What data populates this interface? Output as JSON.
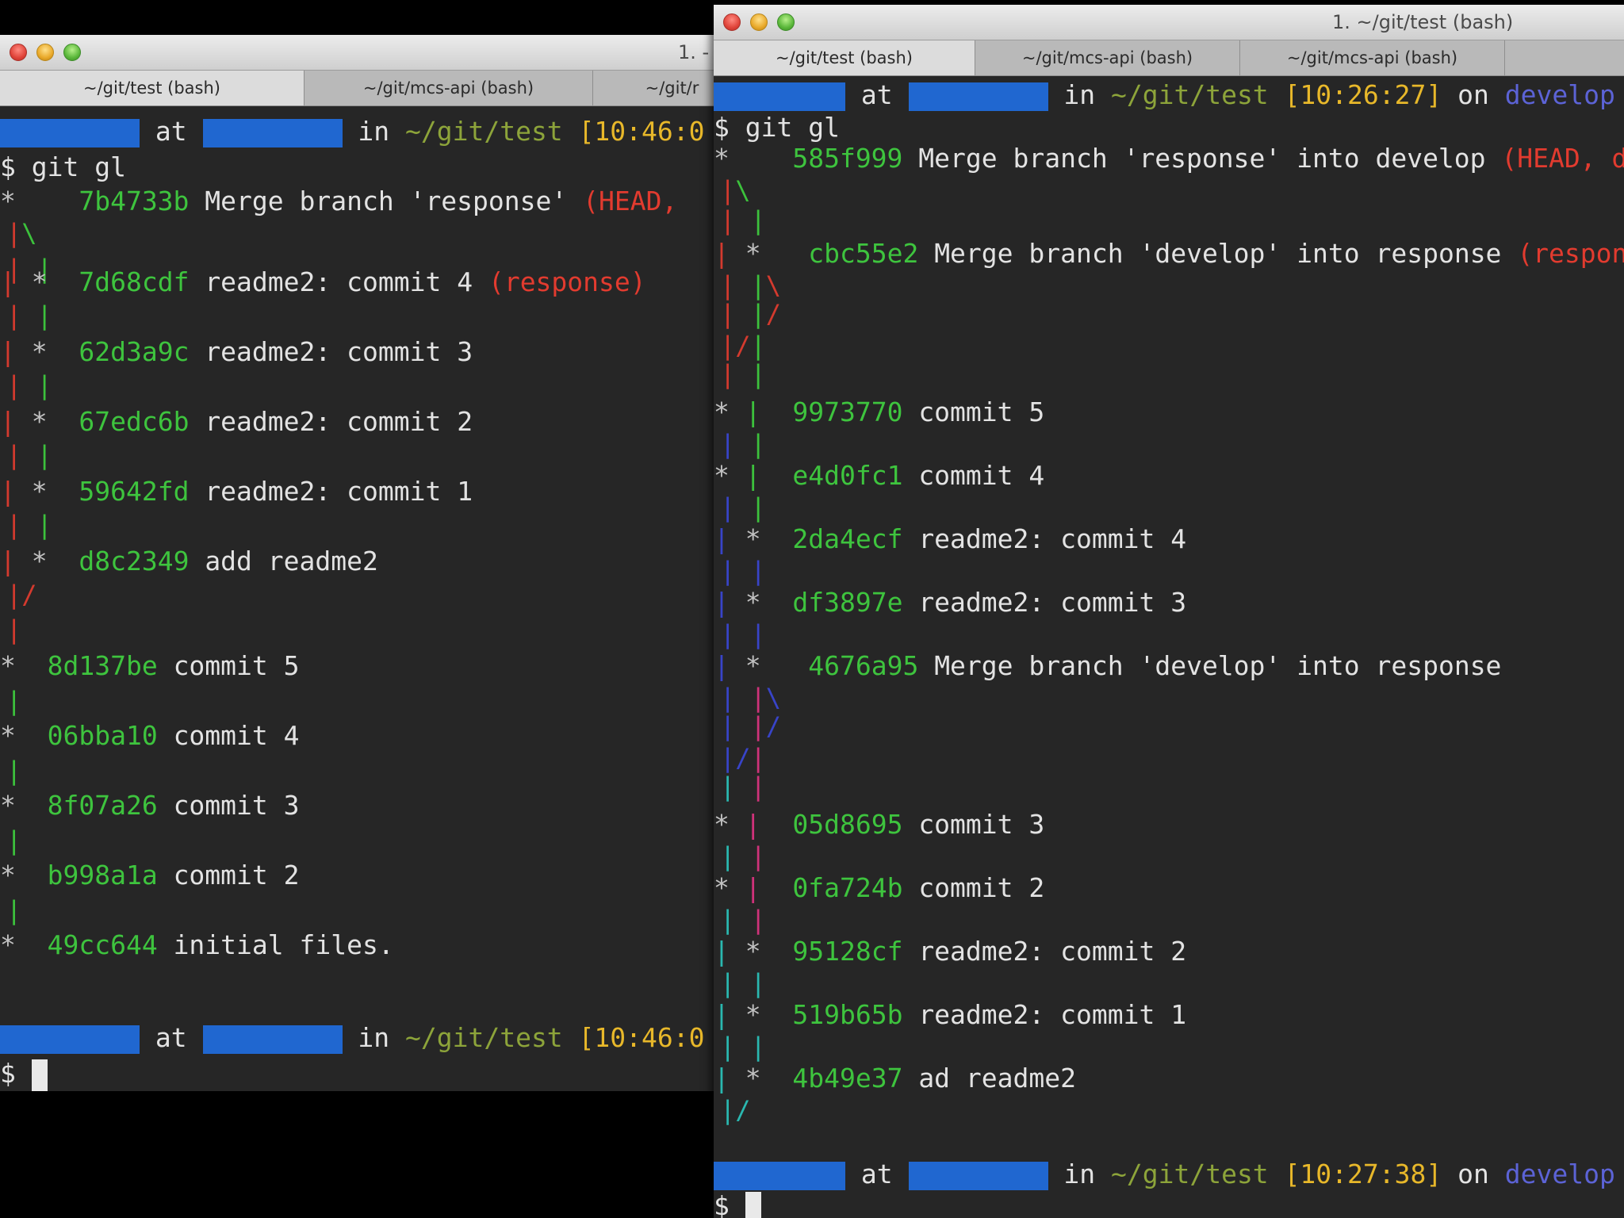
{
  "left_window": {
    "title": "1. -",
    "tabs": [
      "~/git/test (bash)",
      "~/git/mcs-api (bash)",
      "~/git/r"
    ],
    "prompt_at": "at",
    "prompt_in": "in",
    "path": "~/git/test",
    "time_top": "[10:46:0",
    "time_bottom": "[10:46:0",
    "command": "$ git gl",
    "cursor_prompt": "$",
    "graph_commits": [
      {
        "hash": "7b4733b",
        "message": "Merge branch 'response'",
        "ref": "(HEAD,"
      },
      {
        "hash": "7d68cdf",
        "message": "readme2: commit 4",
        "ref": "(response)"
      },
      {
        "hash": "62d3a9c",
        "message": "readme2: commit 3",
        "ref": ""
      },
      {
        "hash": "67edc6b",
        "message": "readme2: commit 2",
        "ref": ""
      },
      {
        "hash": "59642fd",
        "message": "readme2: commit 1",
        "ref": ""
      },
      {
        "hash": "d8c2349",
        "message": "add readme2",
        "ref": ""
      },
      {
        "hash": "8d137be",
        "message": "commit 5",
        "ref": ""
      },
      {
        "hash": "06bba10",
        "message": "commit 4",
        "ref": ""
      },
      {
        "hash": "8f07a26",
        "message": "commit 3",
        "ref": ""
      },
      {
        "hash": "b998a1a",
        "message": "commit 2",
        "ref": ""
      },
      {
        "hash": "49cc644",
        "message": "initial files.",
        "ref": ""
      }
    ]
  },
  "right_window": {
    "title": "1. ~/git/test (bash)",
    "tabs": [
      "~/git/test (bash)",
      "~/git/mcs-api (bash)",
      "~/git/mcs-api (bash)"
    ],
    "prompt_at": "at",
    "prompt_in": "in",
    "prompt_on": "on",
    "path": "~/git/test",
    "time_top": "[10:26:27]",
    "time_bottom": "[10:27:38]",
    "branch": "develop",
    "command": "$ git gl",
    "cursor_prompt": "$",
    "graph_commits": [
      {
        "hash": "585f999",
        "message": "Merge branch 'response' into develop",
        "ref": "(HEAD, dev"
      },
      {
        "hash": "cbc55e2",
        "message": "Merge branch 'develop' into response",
        "ref": "(respons"
      },
      {
        "hash": "9973770",
        "message": "commit 5",
        "ref": ""
      },
      {
        "hash": "e4d0fc1",
        "message": "commit 4",
        "ref": ""
      },
      {
        "hash": "2da4ecf",
        "message": "readme2: commit 4",
        "ref": ""
      },
      {
        "hash": "df3897e",
        "message": "readme2: commit 3",
        "ref": ""
      },
      {
        "hash": "4676a95",
        "message": "Merge branch 'develop' into response",
        "ref": ""
      },
      {
        "hash": "05d8695",
        "message": "commit 3",
        "ref": ""
      },
      {
        "hash": "0fa724b",
        "message": "commit 2",
        "ref": ""
      },
      {
        "hash": "95128cf",
        "message": "readme2: commit 2",
        "ref": ""
      },
      {
        "hash": "519b65b",
        "message": "readme2: commit 1",
        "ref": ""
      },
      {
        "hash": "4b49e37",
        "message": "ad readme2",
        "ref": ""
      }
    ]
  },
  "colors": {
    "terminal_bg": "#262626",
    "hash": "#3ec43e",
    "ref": "#e23b2f",
    "path": "#8da43a",
    "time": "#e8b82a",
    "branch": "#5c63d6",
    "redaction": "#2067d0"
  }
}
